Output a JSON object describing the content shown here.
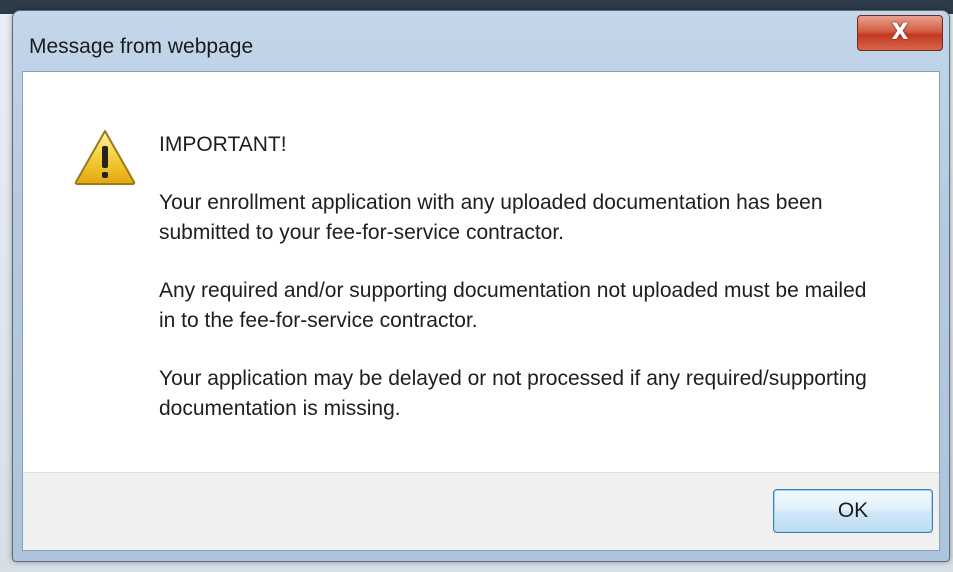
{
  "window": {
    "title": "Message from webpage",
    "close_icon": "close-icon",
    "close_glyph": "X"
  },
  "dialog": {
    "icon": "warning-icon",
    "heading": "IMPORTANT!",
    "paragraphs": [
      "Your enrollment application with any uploaded documentation has been submitted to your fee-for-service contractor.",
      "Any required and/or supporting documentation not uploaded must be mailed in to the fee-for-service contractor.",
      "Your application may be delayed or not processed if any required/supporting documentation is missing."
    ],
    "ok_label": "OK"
  },
  "colors": {
    "close_button": "#c2391f",
    "ok_border": "#3c7fb1",
    "warning_fill": "#f5cf3a",
    "footer_bg": "#f0f0f0"
  }
}
